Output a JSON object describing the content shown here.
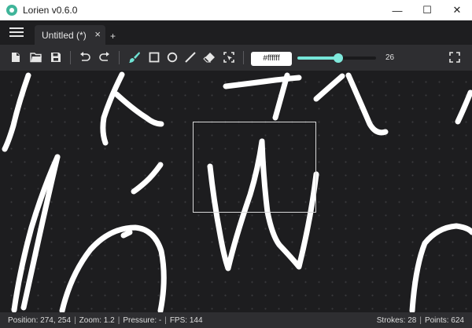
{
  "window": {
    "title": "Lorien v0.6.0",
    "controls": [
      "—",
      "☐",
      "✕"
    ]
  },
  "tabs": [
    {
      "label": "Untitled (*)",
      "close": "×"
    }
  ],
  "add_tab": "+",
  "toolbar": {
    "color_value": "#ffffff",
    "brush_size": "26",
    "brush_size_fraction": 0.52
  },
  "status": {
    "position": "Position: 274, 254",
    "zoom": "Zoom: 1.2",
    "pressure": "Pressure: -",
    "fps": "FPS: 144",
    "strokes": "Strokes: 28",
    "points": "Points: 624",
    "separator": "|"
  },
  "colors": {
    "accent": "#6fe3d4",
    "canvas_bg": "#1d1d1f",
    "stroke": "#ffffff"
  }
}
